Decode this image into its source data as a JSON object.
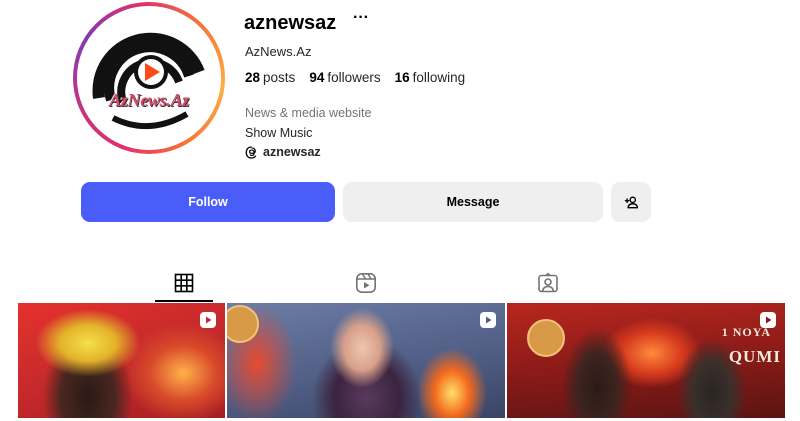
{
  "profile": {
    "username": "aznewsaz",
    "more_icon": "···",
    "full_name": "AzNews.Az",
    "avatar_logo_text": "AzNews.Az",
    "stats": {
      "posts_count": "28",
      "posts_label": "posts",
      "followers_count": "94",
      "followers_label": "followers",
      "following_count": "16",
      "following_label": "following"
    },
    "category": "News & media website",
    "bio": "Show Music",
    "threads_handle": "aznewsaz",
    "threads_icon": "threads-icon"
  },
  "actions": {
    "follow_label": "Follow",
    "message_label": "Message",
    "add_user_icon": "add-user-icon"
  },
  "tabs": [
    {
      "icon": "grid-icon",
      "active": true
    },
    {
      "icon": "reels-icon",
      "active": false
    },
    {
      "icon": "tagged-icon",
      "active": false
    }
  ],
  "posts": [
    {
      "type": "reel",
      "overlay": ""
    },
    {
      "type": "reel",
      "overlay": ""
    },
    {
      "type": "reel",
      "overlay_line1": "1 NOYA",
      "overlay_line2": "QUMI"
    }
  ],
  "colors": {
    "follow_button": "#4a5df9",
    "secondary_button": "#efefef",
    "avatar_ring_start": "#e1306c",
    "avatar_ring_end": "#fcaf45",
    "text_secondary": "#737373"
  }
}
